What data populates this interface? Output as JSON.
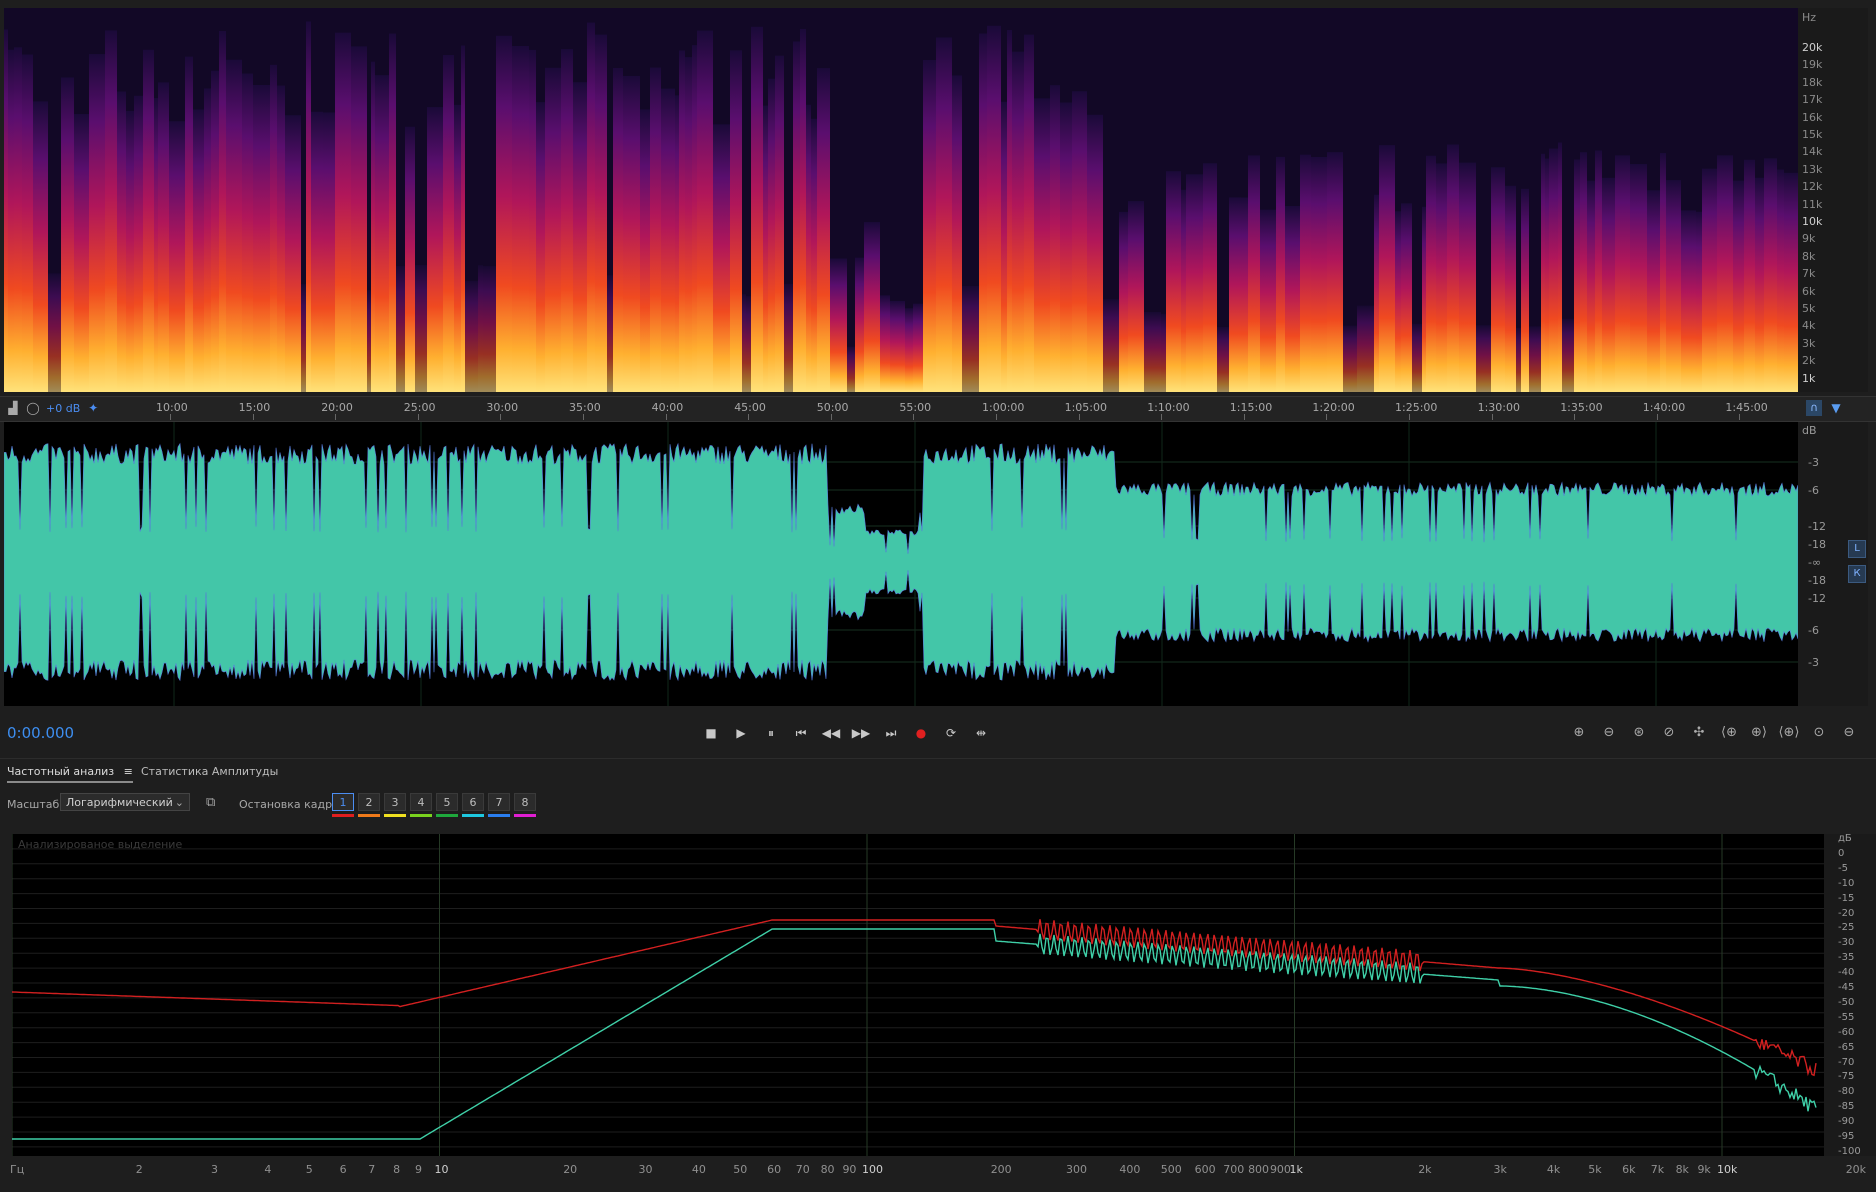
{
  "spectral": {
    "hz_unit": "Hz",
    "hz_ticks": [
      "20k",
      "19k",
      "18k",
      "17k",
      "16k",
      "15k",
      "14k",
      "13k",
      "12k",
      "11k",
      "10k",
      "9k",
      "8k",
      "7k",
      "6k",
      "5k",
      "4k",
      "3k",
      "2k",
      "1k"
    ]
  },
  "timeline": {
    "gain": "+0 dB",
    "ticks": [
      "10:00",
      "15:00",
      "20:00",
      "25:00",
      "30:00",
      "35:00",
      "40:00",
      "45:00",
      "50:00",
      "55:00",
      "1:00:00",
      "1:05:00",
      "1:10:00",
      "1:15:00",
      "1:20:00",
      "1:25:00",
      "1:30:00",
      "1:35:00",
      "1:40:00",
      "1:45:00"
    ]
  },
  "waveform": {
    "db_unit": "dB",
    "db_ticks": [
      "-3",
      "-6",
      "-12",
      "-18",
      "-∞",
      "-18",
      "-12",
      "-6",
      "-3"
    ],
    "channels": [
      "L",
      "К"
    ]
  },
  "transport": {
    "time": "0:00.000",
    "buttons": [
      "stop-icon",
      "play-icon",
      "pause-icon",
      "skip-start-icon",
      "rewind-icon",
      "fast-forward-icon",
      "skip-end-icon",
      "record-icon",
      "loop-icon",
      "skip-selection-icon"
    ],
    "glyphs": [
      "■",
      "▶",
      "⏸",
      "⏮",
      "◀◀",
      "▶▶",
      "⏭",
      "●",
      "⟳",
      "⇹"
    ]
  },
  "zoom_buttons": [
    "⊕",
    "⊖",
    "⊛",
    "⊘",
    "✣",
    "⟨⊕",
    "⊕⟩",
    "⟨⊕⟩",
    "⊙",
    "⊖"
  ],
  "panel": {
    "tab_frequency": "Частотный анализ",
    "tab_frequency_menu": "≡",
    "tab_amplitude": "Статистика Амплитуды",
    "scale_label": "Масштаб:",
    "scale_value": "Логарифмический",
    "freeze_label": "Остановка кадра:",
    "frames": [
      "1",
      "2",
      "3",
      "4",
      "5",
      "6",
      "7",
      "8"
    ],
    "frame_colors": [
      "#e01e1e",
      "#f07a1a",
      "#f0e020",
      "#7ad21e",
      "#1ea83c",
      "#1ec8e0",
      "#2a7ef0",
      "#e01ed2"
    ],
    "analyzed_label": "Анализированое выделение"
  },
  "spectrum": {
    "db_ticks": [
      "дБ",
      "0",
      "-5",
      "-10",
      "-15",
      "-20",
      "-25",
      "-30",
      "-35",
      "-40",
      "-45",
      "-50",
      "-55",
      "-60",
      "-65",
      "-70",
      "-75",
      "-80",
      "-85",
      "-90",
      "-95",
      "-100"
    ],
    "hz_ticks": [
      {
        "label": "Гц",
        "f": 1
      },
      {
        "label": "2",
        "f": 2
      },
      {
        "label": "3",
        "f": 3
      },
      {
        "label": "4",
        "f": 4
      },
      {
        "label": "5",
        "f": 5
      },
      {
        "label": "6",
        "f": 6
      },
      {
        "label": "7",
        "f": 7
      },
      {
        "label": "8",
        "f": 8
      },
      {
        "label": "9",
        "f": 9
      },
      {
        "label": "10",
        "f": 10,
        "strong": true
      },
      {
        "label": "20",
        "f": 20
      },
      {
        "label": "30",
        "f": 30
      },
      {
        "label": "40",
        "f": 40
      },
      {
        "label": "50",
        "f": 50
      },
      {
        "label": "60",
        "f": 60
      },
      {
        "label": "70",
        "f": 70
      },
      {
        "label": "80",
        "f": 80
      },
      {
        "label": "90",
        "f": 90
      },
      {
        "label": "100",
        "f": 100,
        "strong": true
      },
      {
        "label": "200",
        "f": 200
      },
      {
        "label": "300",
        "f": 300
      },
      {
        "label": "400",
        "f": 400
      },
      {
        "label": "500",
        "f": 500
      },
      {
        "label": "600",
        "f": 600
      },
      {
        "label": "700",
        "f": 700
      },
      {
        "label": "800",
        "f": 800
      },
      {
        "label": "900",
        "f": 900
      },
      {
        "label": "1k",
        "f": 1000,
        "strong": true
      },
      {
        "label": "2k",
        "f": 2000
      },
      {
        "label": "3k",
        "f": 3000
      },
      {
        "label": "4k",
        "f": 4000
      },
      {
        "label": "5k",
        "f": 5000
      },
      {
        "label": "6k",
        "f": 6000
      },
      {
        "label": "7k",
        "f": 7000
      },
      {
        "label": "8k",
        "f": 8000
      },
      {
        "label": "9k",
        "f": 9000
      },
      {
        "label": "10k",
        "f": 10000,
        "strong": true
      },
      {
        "label": "20k",
        "f": 20000
      }
    ],
    "colors": {
      "left": "#d22020",
      "right": "#3fd0a8"
    }
  }
}
